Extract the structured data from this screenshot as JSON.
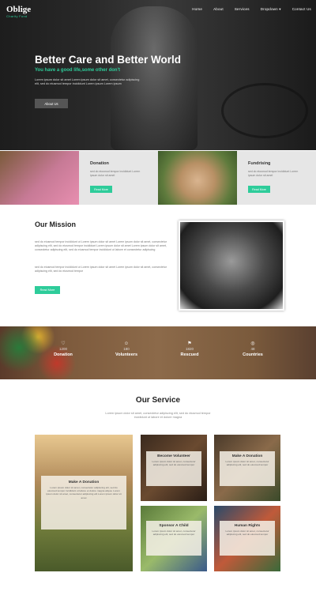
{
  "brand": {
    "name": "Oblige",
    "tagline": "Charity Fund"
  },
  "nav": {
    "items": [
      "Home",
      "About",
      "Services",
      "Dropdown ▾",
      "Contact Us"
    ]
  },
  "hero": {
    "heading": "Better Care and Better World",
    "tagline": "You have a good life,some other don't",
    "body": "Lorem ipsum dolor sit amet Lorem ipsum dolor sit amet, consectetur adipiscing elit, sed do eiusmod tempor incididunt Lorem ipsum Lorem ipsum",
    "button": "About Us"
  },
  "cards": [
    {
      "title": "Donation",
      "text": "sed do eiusmod tempor incididunt Lorem ipsum dolor sit amet",
      "button": "Read More"
    },
    {
      "title": "Fundrising",
      "text": "sed do eiusmod tempor incididunt Lorem ipsum dolor sit amet",
      "button": "Read More"
    }
  ],
  "mission": {
    "heading": "Our Mission",
    "p1": "sed do eiusmod tempor incididunt ut Lorem ipsum dolor sit amet Lorem ipsum dolor sit amet, consectetur adipiscing elit, sed do eiusmod tempor incididunt Lorem ipsum dolor sit amet Lorem ipsum dolor sit amet, consectetur adipiscing elit, sed do eiusmod tempor incididunt ut labore et consectetur adipiscing",
    "p2": "sed do eiusmod tempor incididunt ut Lorem ipsum dolor sit amet Lorem ipsum dolor sit amet, consectetur adipiscing elit, sed do eiusmod tempor",
    "button": "Read More"
  },
  "stats": [
    {
      "icon": "♡",
      "number": "1200",
      "label": "Donation"
    },
    {
      "icon": "☺",
      "number": "180",
      "label": "Volunteers"
    },
    {
      "icon": "⚑",
      "number": "1820",
      "label": "Rescued"
    },
    {
      "icon": "◎",
      "number": "48",
      "label": "Countries"
    }
  ],
  "service": {
    "heading": "Our Service",
    "subtitle": "Lorem ipsum dolor sit amet, consectetur adipiscing elit, sed do eiusmod tempor incididunt ut labore et dolore magna",
    "tiles": [
      {
        "title": "Make A Donation",
        "text": "Lorem ipsum dolor sit amet, consectetur adipiscing elit, sed do eiusmod tempor incididunt ut labore et dolore magna aliqua. Lorem ipsum dolor sit amet, consectetur adipiscing elit Lorem ipsum dolor sit amet"
      },
      {
        "title": "Become Volunteer",
        "text": "Lorem ipsum dolor sit amet, consectetur adipiscing elit, sed do eiusmod tempor"
      },
      {
        "title": "Make A Donation",
        "text": "Lorem ipsum dolor sit amet, consectetur adipiscing elit, sed do eiusmod tempor"
      },
      {
        "title": "Sponsor A Child",
        "text": "Lorem ipsum dolor sit amet, consectetur adipiscing elit, sed do eiusmod tempor"
      },
      {
        "title": "Human Rights",
        "text": "Lorem ipsum dolor sit amet, consectetur adipiscing elit, sed do eiusmod tempor"
      }
    ]
  },
  "colors": {
    "accent": "#2ecc9a",
    "dark": "#1d1d1d",
    "stats_bg": "#7d5a3c"
  }
}
